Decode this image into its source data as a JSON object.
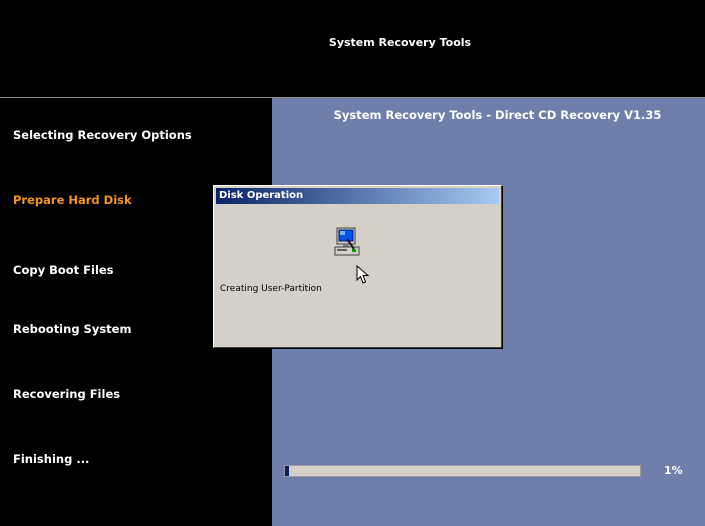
{
  "header": {
    "title": "System Recovery Tools"
  },
  "sidebar": {
    "steps": [
      {
        "label": "Selecting Recovery Options",
        "state": "done"
      },
      {
        "label": "Prepare Hard Disk",
        "state": "active"
      },
      {
        "label": "Copy Boot Files",
        "state": "pending"
      },
      {
        "label": "Rebooting System",
        "state": "pending"
      },
      {
        "label": "Recovering Files",
        "state": "pending"
      },
      {
        "label": "Finishing ...",
        "state": "pending"
      }
    ]
  },
  "main": {
    "title": "System Recovery Tools - Direct CD Recovery V1.35",
    "progress": {
      "value": 1,
      "label": "1%"
    }
  },
  "dialog": {
    "title": "Disk Operation",
    "icon": "computer-icon",
    "message": "Creating User-Partition"
  },
  "colors": {
    "background": "#000000",
    "main_panel": "#6f7fab",
    "active_step": "#f7941d",
    "titlebar_start": "#0a246a",
    "titlebar_end": "#a6caf0",
    "dialog_face": "#d4d0c8",
    "progress_fill": "#0a1c6c"
  }
}
